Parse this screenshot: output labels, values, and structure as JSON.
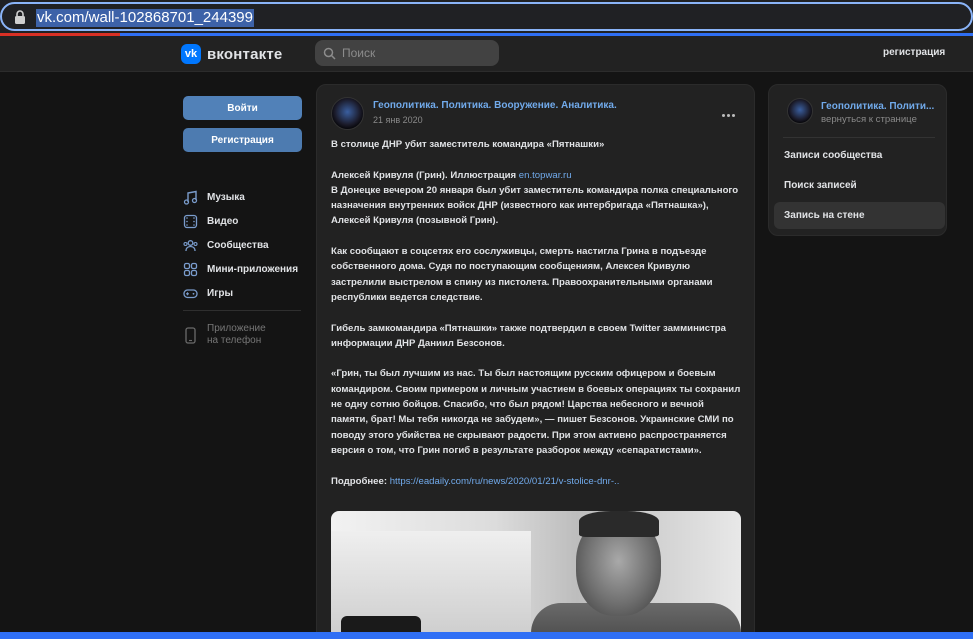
{
  "browser": {
    "url": "vk.com/wall-102868701_244399"
  },
  "header": {
    "logo_text": "вконтакте",
    "logo_mark": "vk",
    "search_placeholder": "Поиск",
    "register_link": "регистрация"
  },
  "sidebar": {
    "login_button": "Войти",
    "register_button": "Регистрация",
    "items": [
      {
        "label": "Музыка",
        "icon": "music-icon"
      },
      {
        "label": "Видео",
        "icon": "video-icon"
      },
      {
        "label": "Сообщества",
        "icon": "communities-icon"
      },
      {
        "label": "Мини-приложения",
        "icon": "mini-apps-icon"
      },
      {
        "label": "Игры",
        "icon": "gamepad-icon"
      }
    ],
    "app_phone_line1": "Приложение",
    "app_phone_line2": "на телефон"
  },
  "post": {
    "author": "Геополитика. Политика. Вооружение. Аналитика.",
    "date": "21 янв 2020",
    "title": "В столице ДНР убит заместитель командира «Пятнашки»",
    "illustration_prefix": "Алексей Кривуля (Грин). Иллюстрация ",
    "illustration_link": "en.topwar.ru",
    "p1": "В Донецке вечером 20 января был убит заместитель командира полка специального назначения внутренних войск ДНР (известного как интербригада «Пятнашка»), Алексей Кривуля (позывной Грин).",
    "p2": "Как сообщают в соцсетях его сослуживцы, смерть настигла Грина в подъезде собственного дома. Судя по поступающим сообщениям, Алексея Кривулю застрелили выстрелом в спину из пистолета. Правоохранительными органами республики ведется следствие.",
    "p3": "Гибель замкомандира «Пятнашки» также подтвердил в своем Twitter замминистра информации ДНР Даниил Безсонов.",
    "p4": "«Грин, ты был лучшим из нас. Ты был настоящим русским офицером и боевым командиром. Своим примером и личным участием в боевых операциях ты сохранил не одну сотню бойцов. Спасибо, что был рядом! Царства небесного и вечной памяти, брат! Мы тебя никогда не забудем», — пишет Безсонов. Украинские СМИ по поводу этого убийства не скрывают радости. При этом активно распространяется версия о том, что Грин погиб в результате разборок между «сепаратистами».",
    "more_prefix": "Подробнее: ",
    "more_link": "https://eadaily.com/ru/news/2020/01/21/v-stolice-dnr-.."
  },
  "widget": {
    "name": "Геополитика. Полити...",
    "back": "вернуться к странице",
    "items": [
      {
        "label": "Записи сообщества"
      },
      {
        "label": "Поиск записей"
      },
      {
        "label": "Запись на стене"
      }
    ]
  },
  "colors": {
    "accent": "#71aaeb",
    "button": "#4a76a8",
    "background": "#141414",
    "card": "#222222"
  }
}
